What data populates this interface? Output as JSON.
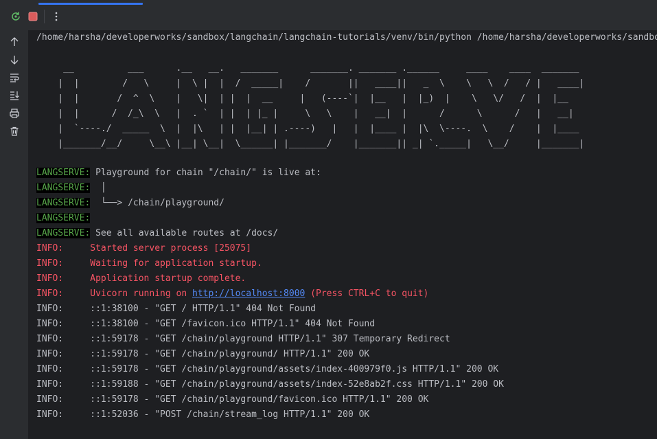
{
  "toolbar": {
    "rerun_icon": "rerun-icon",
    "stop_icon": "stop-icon",
    "more_icon": "more-vertical-icon",
    "accent": "#3574f0"
  },
  "sidebar": {
    "items": [
      {
        "name": "scroll-up-icon"
      },
      {
        "name": "scroll-down-icon"
      },
      {
        "name": "soft-wrap-icon"
      },
      {
        "name": "scroll-to-end-icon"
      },
      {
        "name": "print-icon"
      },
      {
        "name": "clear-all-icon"
      }
    ]
  },
  "console": {
    "command": "/home/harsha/developerworks/sandbox/langchain/langchain-tutorials/venv/bin/python /home/harsha/developerworks/sandbox/langchain/langchain-tutorials/serve.py",
    "banner": "     __          ___      .__   __.   _______      _______. _______ .______     ____    ____  _______\n    |  |        /   \\     |  \\ |  |  /  _____|    /       ||   ____||   _  \\    \\   \\  /   / |   ____|\n    |  |       /  ^  \\    |   \\|  | |  |  __     |   (----`|  |__   |  |_)  |    \\   \\/   /  |  |__\n    |  |      /  /_\\  \\   |  . `  | |  | |_ |     \\   \\    |   __|  |      /      \\      /   |   __|\n    |  `----./  _____  \\  |  |\\   | |  |__| | .----)   |   |  |____ |  |\\  \\----.  \\    /    |  |____\n    |_______/__/     \\__\\ |__| \\__|  \\______| |_______/    |_______|| _| `._____|   \\__/     |_______|",
    "langserve_tag": "LANGSERVE:",
    "langserve": [
      " Playground for chain \"/chain/\" is live at:",
      "  │",
      "  └──> /chain/playground/",
      "",
      " See all available routes at /docs/"
    ],
    "info_red": [
      {
        "label": "INFO:",
        "text": "     Started server process [25075]"
      },
      {
        "label": "INFO:",
        "text": "     Waiting for application startup."
      },
      {
        "label": "INFO:",
        "text": "     Application startup complete."
      }
    ],
    "uvicorn": {
      "label": "INFO:",
      "prefix": "     Uvicorn running on ",
      "link": "http://localhost:8000",
      "suffix": " (Press CTRL+C to quit)"
    },
    "info_lines": [
      {
        "label": "INFO:",
        "text": "     ::1:38100 - \"GET / HTTP/1.1\" 404 Not Found"
      },
      {
        "label": "INFO:",
        "text": "     ::1:38100 - \"GET /favicon.ico HTTP/1.1\" 404 Not Found"
      },
      {
        "label": "INFO:",
        "text": "     ::1:59178 - \"GET /chain/playground HTTP/1.1\" 307 Temporary Redirect"
      },
      {
        "label": "INFO:",
        "text": "     ::1:59178 - \"GET /chain/playground/ HTTP/1.1\" 200 OK"
      },
      {
        "label": "INFO:",
        "text": "     ::1:59178 - \"GET /chain/playground/assets/index-400979f0.js HTTP/1.1\" 200 OK"
      },
      {
        "label": "INFO:",
        "text": "     ::1:59188 - \"GET /chain/playground/assets/index-52e8ab2f.css HTTP/1.1\" 200 OK"
      },
      {
        "label": "INFO:",
        "text": "     ::1:59178 - \"GET /chain/playground/favicon.ico HTTP/1.1\" 200 OK"
      },
      {
        "label": "INFO:",
        "text": "     ::1:52036 - \"POST /chain/stream_log HTTP/1.1\" 200 OK"
      }
    ],
    "colors": {
      "langserve": "#57a64a",
      "error": "#f75464",
      "text": "#bcbec4",
      "link": "#548af7"
    }
  }
}
